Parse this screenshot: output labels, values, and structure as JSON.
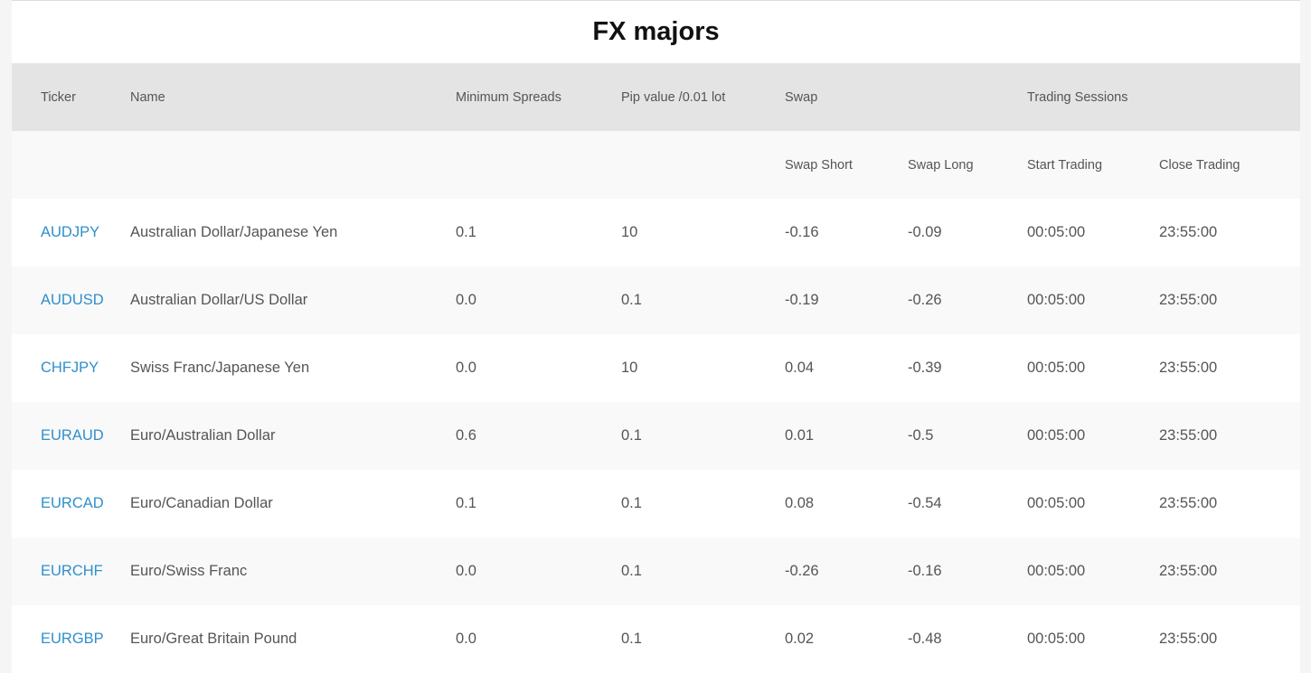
{
  "page": {
    "title": "FX majors"
  },
  "table": {
    "headers": {
      "ticker": "Ticker",
      "name": "Name",
      "min_spreads": "Minimum Spreads",
      "pip_value": "Pip value /0.01 lot",
      "swap": "Swap",
      "trading_sessions": "Trading Sessions"
    },
    "subheaders": {
      "swap_short": "Swap Short",
      "swap_long": "Swap Long",
      "start_trading": "Start Trading",
      "close_trading": "Close Trading"
    },
    "rows": [
      {
        "ticker": "AUDJPY",
        "name": "Australian Dollar/Japanese Yen",
        "min_spread": "0.1",
        "pip_value": "10",
        "swap_short": "-0.16",
        "swap_long": "-0.09",
        "start": "00:05:00",
        "close": "23:55:00"
      },
      {
        "ticker": "AUDUSD",
        "name": "Australian Dollar/US Dollar",
        "min_spread": "0.0",
        "pip_value": "0.1",
        "swap_short": "-0.19",
        "swap_long": "-0.26",
        "start": "00:05:00",
        "close": "23:55:00"
      },
      {
        "ticker": "CHFJPY",
        "name": "Swiss Franc/Japanese Yen",
        "min_spread": "0.0",
        "pip_value": "10",
        "swap_short": "0.04",
        "swap_long": "-0.39",
        "start": "00:05:00",
        "close": "23:55:00"
      },
      {
        "ticker": "EURAUD",
        "name": "Euro/Australian Dollar",
        "min_spread": "0.6",
        "pip_value": "0.1",
        "swap_short": "0.01",
        "swap_long": "-0.5",
        "start": "00:05:00",
        "close": "23:55:00"
      },
      {
        "ticker": "EURCAD",
        "name": "Euro/Canadian Dollar",
        "min_spread": "0.1",
        "pip_value": "0.1",
        "swap_short": "0.08",
        "swap_long": "-0.54",
        "start": "00:05:00",
        "close": "23:55:00"
      },
      {
        "ticker": "EURCHF",
        "name": "Euro/Swiss Franc",
        "min_spread": "0.0",
        "pip_value": "0.1",
        "swap_short": "-0.26",
        "swap_long": "-0.16",
        "start": "00:05:00",
        "close": "23:55:00"
      },
      {
        "ticker": "EURGBP",
        "name": "Euro/Great Britain Pound",
        "min_spread": "0.0",
        "pip_value": "0.1",
        "swap_short": "0.02",
        "swap_long": "-0.48",
        "start": "00:05:00",
        "close": "23:55:00"
      }
    ]
  },
  "colors": {
    "ticker_link": "#2f8fcb",
    "header_bg": "#e4e4e4",
    "row_alt_bg": "#f9f9f9",
    "text": "#555555"
  }
}
